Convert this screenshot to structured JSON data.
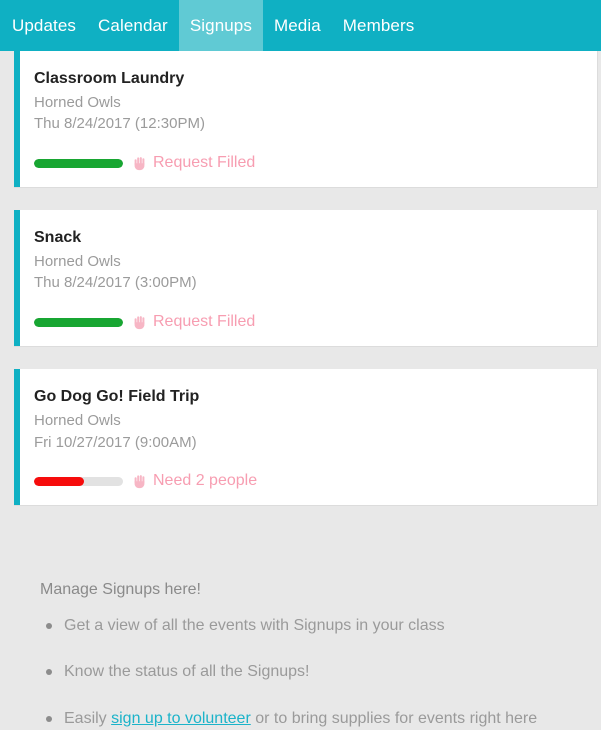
{
  "nav": {
    "tabs": [
      {
        "label": "Updates",
        "active": false
      },
      {
        "label": "Calendar",
        "active": false
      },
      {
        "label": "Signups",
        "active": true
      },
      {
        "label": "Media",
        "active": false
      },
      {
        "label": "Members",
        "active": false
      }
    ],
    "background_color": "#0fb0c3",
    "active_tab_color": "#60cad4"
  },
  "signups": [
    {
      "title": "Classroom Laundry",
      "group": "Horned Owls",
      "date": "Thu 8/24/2017 (12:30PM)",
      "status_text": "Request Filled",
      "status_icon": "raised-hand-icon",
      "progress_percent": 100,
      "progress_color": "#18a632"
    },
    {
      "title": "Snack",
      "group": "Horned Owls",
      "date": "Thu 8/24/2017 (3:00PM)",
      "status_text": "Request Filled",
      "status_icon": "raised-hand-icon",
      "progress_percent": 100,
      "progress_color": "#18a632"
    },
    {
      "title": "Go Dog Go! Field Trip",
      "group": "Horned Owls",
      "date": "Fri 10/27/2017 (9:00AM)",
      "status_text": "Need 2 people",
      "status_icon": "raised-hand-icon",
      "progress_percent": 56,
      "progress_color": "#f60c0c"
    }
  ],
  "info_panel": {
    "heading": "Manage Signups here!",
    "bullets": [
      {
        "text_before": "Get a view of all the events with Signups in your class",
        "link": "",
        "text_after": ""
      },
      {
        "text_before": "Know the status of all the Signups!",
        "link": "",
        "text_after": ""
      },
      {
        "text_before": "Easily ",
        "link": "sign up to volunteer",
        "text_after": " or to bring supplies for events right here"
      }
    ],
    "link_color": "#1bb3c9"
  }
}
